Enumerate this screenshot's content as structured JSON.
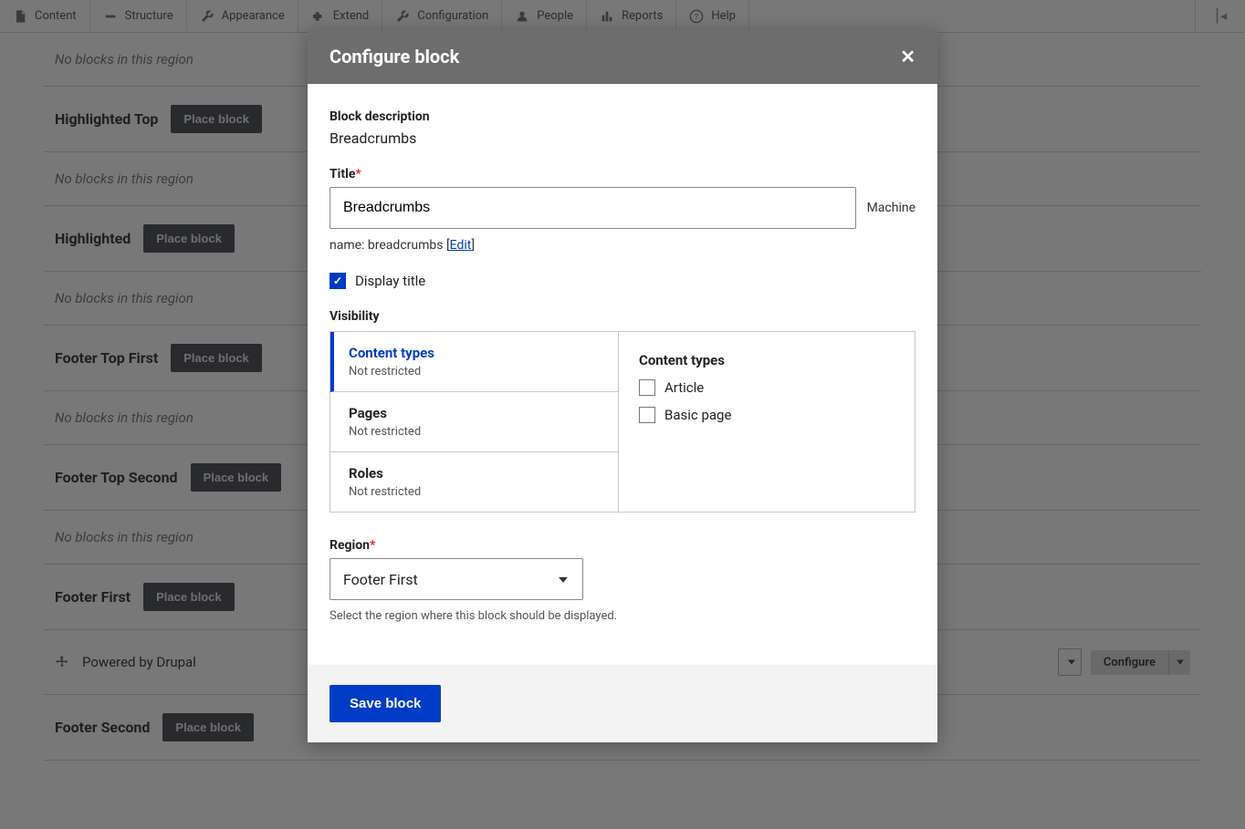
{
  "toolbar": {
    "items": [
      "Content",
      "Structure",
      "Appearance",
      "Extend",
      "Configuration",
      "People",
      "Reports",
      "Help"
    ]
  },
  "regions": [
    {
      "type": "empty",
      "text": "No blocks in this region"
    },
    {
      "type": "header",
      "name": "Highlighted Top",
      "btn": "Place block"
    },
    {
      "type": "empty",
      "text": "No blocks in this region"
    },
    {
      "type": "header",
      "name": "Highlighted",
      "btn": "Place block"
    },
    {
      "type": "empty",
      "text": "No blocks in this region"
    },
    {
      "type": "header",
      "name": "Footer Top First",
      "btn": "Place block"
    },
    {
      "type": "empty",
      "text": "No blocks in this region"
    },
    {
      "type": "header",
      "name": "Footer Top Second",
      "btn": "Place block"
    },
    {
      "type": "empty",
      "text": "No blocks in this region"
    },
    {
      "type": "header",
      "name": "Footer First",
      "btn": "Place block"
    },
    {
      "type": "block",
      "text": "Powered by Drupal",
      "actionLabel": "Configure"
    },
    {
      "type": "header",
      "name": "Footer Second",
      "btn": "Place block"
    }
  ],
  "modal": {
    "title": "Configure block",
    "descLabel": "Block description",
    "descValue": "Breadcrumbs",
    "titleLabel": "Title",
    "titleValue": "Breadcrumbs",
    "machineSide": "Machine",
    "machineName": "name: breadcrumbs",
    "editLink": "Edit",
    "displayTitleLabel": "Display title",
    "visLabel": "Visibility",
    "tabs": [
      {
        "t": "Content types",
        "s": "Not restricted",
        "active": true
      },
      {
        "t": "Pages",
        "s": "Not restricted"
      },
      {
        "t": "Roles",
        "s": "Not restricted"
      }
    ],
    "panelTitle": "Content types",
    "panelChecks": [
      "Article",
      "Basic page"
    ],
    "regionLabel": "Region",
    "regionValue": "Footer First",
    "regionHint": "Select the region where this block should be displayed.",
    "saveBtn": "Save block"
  }
}
